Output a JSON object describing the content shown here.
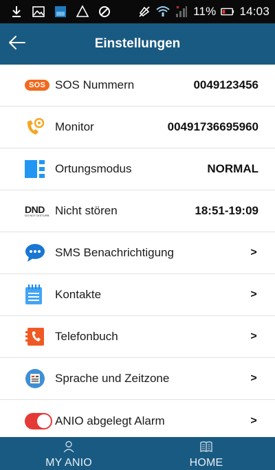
{
  "status_bar": {
    "battery_percent": "11%",
    "time": "14:03",
    "icons": [
      "download-icon",
      "image-icon",
      "app-icon",
      "warning-icon",
      "blocked-icon",
      "mute-icon",
      "wifi-icon",
      "signal-icon",
      "battery-icon"
    ]
  },
  "app_bar": {
    "title": "Einstellungen",
    "back_icon": "arrow-left-icon"
  },
  "settings": [
    {
      "icon": "sos-icon",
      "badge": "SOS",
      "label": "SOS Nummern",
      "value": "0049123456"
    },
    {
      "icon": "phone-monitor-icon",
      "label": "Monitor",
      "value": "00491736695960"
    },
    {
      "icon": "location-mode-icon",
      "label": "Ortungsmodus",
      "value": "NORMAL"
    },
    {
      "icon": "dnd-icon",
      "dnd_text": "DND",
      "dnd_sub": "DO NOT DISTURB",
      "label": "Nicht stören",
      "value": "18:51-19:09"
    },
    {
      "icon": "chat-bubble-icon",
      "label": "SMS Benachrichtigung",
      "chevron": ">"
    },
    {
      "icon": "notepad-icon",
      "label": "Kontakte",
      "chevron": ">"
    },
    {
      "icon": "phonebook-icon",
      "label": "Telefonbuch",
      "chevron": ">"
    },
    {
      "icon": "language-timezone-icon",
      "label": "Sprache und Zeitzone",
      "chevron": ">"
    },
    {
      "icon": "toggle-icon",
      "label": "ANIO abgelegt Alarm",
      "chevron": ">",
      "toggle_on": true
    }
  ],
  "bottom_nav": [
    {
      "icon": "person-icon",
      "label": "MY ANIO"
    },
    {
      "icon": "book-icon",
      "label": "HOME"
    }
  ],
  "colors": {
    "primary": "#195a82",
    "accent_orange": "#f16a1e",
    "toggle_red": "#e53935",
    "icon_blue": "#2196f3"
  }
}
